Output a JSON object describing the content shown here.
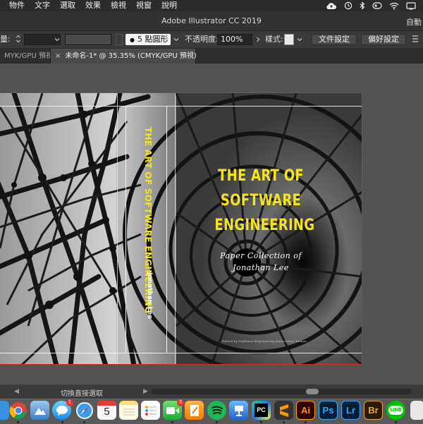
{
  "menubar": {
    "items": [
      "物件",
      "文字",
      "選取",
      "效果",
      "檢視",
      "視窗",
      "說明"
    ]
  },
  "status_icons": [
    "cloud-upload-icon",
    "time-machine-icon",
    "bluetooth-icon",
    "sync-icon",
    "wifi-icon",
    "display-icon"
  ],
  "window": {
    "title": "Adobe Illustrator CC 2019",
    "workspace": "自動"
  },
  "controlbar": {
    "stroke_label": "量:",
    "brush_label": "5 點圓形",
    "opacity_label": "不透明度:",
    "opacity_value": "100%",
    "style_label": "樣式:",
    "document_setup_button": "文件設定",
    "preferences_button": "偏好設定"
  },
  "tabs": {
    "inactive_label": "MYK/GPU 預視)",
    "active_label": "未命名-1* @ 35.35% (CMYK/GPU 預視)",
    "close_symbol": "×"
  },
  "artboard": {
    "spine_title": "THE ART OF SOFTWARE ENGINEERING",
    "spine_author": "Jonathan Lee",
    "cover_title_lines": [
      "THE ART OF",
      "SOFTWARE",
      "ENGINEERING"
    ],
    "cover_subtitle_lines": [
      "Paper Collection of",
      "Jonathan Lee"
    ],
    "cover_credit": "Edited by Software Engineering Association Taiwan",
    "colors": {
      "title_yellow": "#f2e324",
      "artboard_border": "#d9272e"
    }
  },
  "statusbar": {
    "label": "切換直接選取"
  },
  "dock": {
    "icons": [
      "finder-icon",
      "chrome-icon",
      "preview-icon",
      "messages-icon",
      "safari-icon",
      "calendar-icon",
      "notes-icon",
      "reminders-icon",
      "facetime-icon",
      "pages-icon",
      "spotify-icon",
      "keynote-icon",
      "pycharm-icon",
      "sublime-text-icon",
      "illustrator-icon",
      "photoshop-icon",
      "lightroom-icon",
      "bridge-icon",
      "line-icon"
    ],
    "calendar_date": "5",
    "messages_badge": "1",
    "facetime_badge": "3",
    "illustrator_label": "Ai",
    "photoshop_label": "Ps",
    "lightroom_label": "Lr",
    "bridge_label": "Br",
    "pycharm_label": "PC",
    "line_label": "LINE"
  }
}
